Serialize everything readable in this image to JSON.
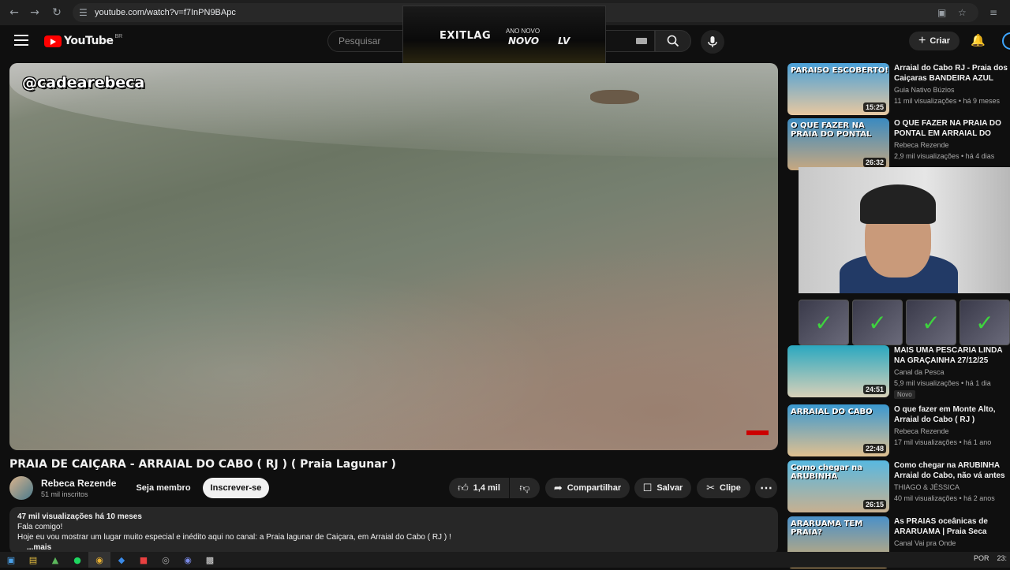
{
  "browser": {
    "url": "youtube.com/watch?v=f7InPN9BApc",
    "back_icon": "arrow-left-icon",
    "forward_icon": "arrow-right-icon",
    "reload_icon": "reload-icon"
  },
  "header": {
    "logo_text": "YouTube",
    "country": "BR",
    "search_placeholder": "Pesquisar",
    "create_label": "Criar"
  },
  "ad": {
    "brand": "EXITLAG",
    "tagline_small": "ANO NOVO",
    "tagline_big": "NOVO",
    "tagline_suffix": "LV"
  },
  "video": {
    "watermark": "@cadearebeca",
    "title": "PRAIA DE CAIÇARA - ARRAIAL DO CABO ( RJ ) ( Praia Lagunar )",
    "channel": "Rebeca Rezende",
    "subscribers": "51 mil inscritos",
    "join_label": "Seja membro",
    "subscribe_label": "Inscrever-se",
    "likes": "1,4 mil",
    "share_label": "Compartilhar",
    "save_label": "Salvar",
    "clip_label": "Clipe",
    "description": {
      "meta": "47 mil visualizações  há 10 meses",
      "line1": "Fala comigo!",
      "line2": "Hoje eu vou mostrar um lugar muito especial e inédito aqui no canal: a Praia lagunar de Caiçara, em Arraial do Cabo ( RJ ) !",
      "more": "...mais"
    }
  },
  "recommendations": [
    {
      "title": "Arraial do Cabo RJ - Praia dos Caiçaras BANDEIRA AZUL",
      "channel": "Guia Nativo Búzios",
      "stats": "11 mil visualizações • há 9 meses",
      "duration": "15:25",
      "thumb_text": "PARAISO ESCOBERTO!",
      "colors": [
        "#4aa0d8",
        "#e8c8a0"
      ]
    },
    {
      "title": "O QUE FAZER NA PRAIA DO PONTAL EM ARRAIAL DO CABO",
      "channel": "Rebeca Rezende",
      "stats": "2,9 mil visualizações • há 4 dias",
      "duration": "26:32",
      "thumb_text": "O QUE FAZER NA PRAIA DO PONTAL",
      "colors": [
        "#3a8ac0",
        "#c8a880"
      ]
    },
    {
      "title": "MAIS UMA PESCARIA LINDA NA GRAÇAINHA 27/12/25",
      "channel": "Canal da Pesca",
      "stats": "5,9 mil visualizações • há 1 dia",
      "duration": "24:51",
      "thumb_text": "",
      "badge": "Novo",
      "colors": [
        "#2aa8c0",
        "#d8d0b8"
      ]
    },
    {
      "title": "O que fazer em Monte Alto, Arraial do Cabo ( RJ )",
      "channel": "Rebeca Rezende",
      "stats": "17 mil visualizações • há 1 ano",
      "duration": "22:48",
      "thumb_text": "ARRAIAL DO CABO",
      "colors": [
        "#3a98d0",
        "#e0c090"
      ]
    },
    {
      "title": "Como chegar na ARUBINHA Arraial do Cabo, não vá antes ...",
      "channel": "THIAGO & JÉSSICA",
      "stats": "40 mil visualizações • há 2 anos",
      "duration": "26:15",
      "thumb_text": "Como chegar na ARUBINHA",
      "colors": [
        "#58b8e0",
        "#c8b090"
      ]
    },
    {
      "title": "As PRAIAS oceânicas de ARARUAMA | Praia Seca",
      "channel": "Canal Vai pra Onde",
      "stats": "",
      "duration": "",
      "thumb_text": "ARARUAMA TEM PRAIA?",
      "colors": [
        "#4a90c8",
        "#d8b070"
      ]
    }
  ],
  "taskbar": {
    "lang": "POR",
    "time": "23:"
  }
}
